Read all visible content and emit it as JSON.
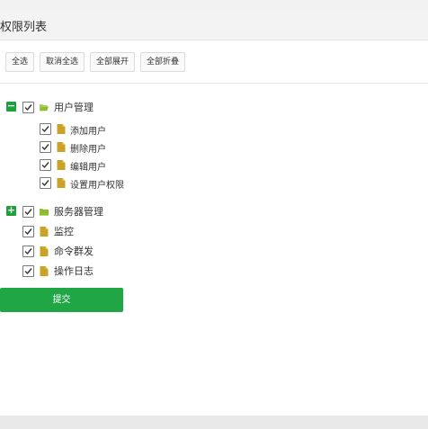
{
  "header": {
    "title": "权限列表"
  },
  "toolbar": {
    "select_all": "全选",
    "cancel_select_all": "取消全选",
    "expand_all": "全部展开",
    "collapse_all": "全部折叠"
  },
  "tree": {
    "user_management": {
      "label": "用户管理",
      "expanded": true,
      "checked": true,
      "children": {
        "add_user": {
          "label": "添加用户",
          "checked": true
        },
        "delete_user": {
          "label": "删除用户",
          "checked": true
        },
        "edit_user": {
          "label": "编辑用户",
          "checked": true
        },
        "set_permissions": {
          "label": "设置用户权限",
          "checked": true
        }
      }
    },
    "server_management": {
      "label": "服务器管理",
      "expanded": false,
      "checked": true
    },
    "monitor": {
      "label": "监控",
      "checked": true
    },
    "command_broadcast": {
      "label": "命令群发",
      "checked": true
    },
    "operation_log": {
      "label": "操作日志",
      "checked": true
    }
  },
  "submit_label": "提交",
  "colors": {
    "accent_green": "#1aa23b",
    "submit_green": "#21a646",
    "folder_green": "#8bbf2e",
    "file_gold": "#c9a227"
  },
  "icons": {
    "collapse": "minus-icon",
    "expand": "plus-icon",
    "folder_open": "folder-open-icon",
    "folder": "folder-icon",
    "file": "file-icon",
    "checkbox": "checkmark-icon"
  }
}
